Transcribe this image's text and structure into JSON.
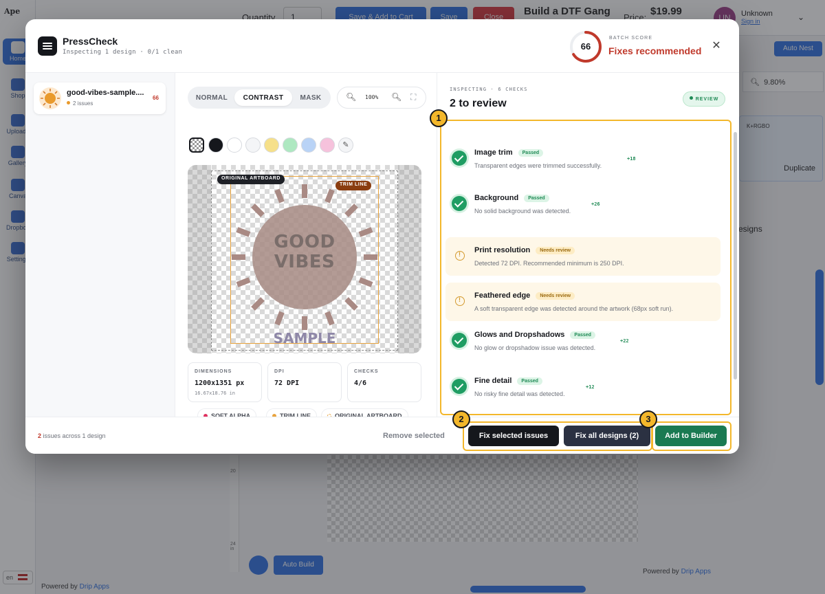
{
  "background_app": {
    "logo_text": "Ape",
    "nav": [
      {
        "label": "Home",
        "active": true
      },
      {
        "label": "Shop",
        "active": false
      },
      {
        "label": "Uploads",
        "active": false
      },
      {
        "label": "Gallery",
        "active": false
      },
      {
        "label": "Canva",
        "active": false
      },
      {
        "label": "Dropbox",
        "active": false
      },
      {
        "label": "Settings",
        "active": false
      }
    ],
    "quantity_label": "Quantity",
    "quantity_value": "1",
    "buttons": {
      "save_add_cart": "Save & Add to Cart",
      "save": "Save",
      "close": "Close"
    },
    "page_title": "Build a DTF Gang",
    "price_label": "Price:",
    "price": "$19.99",
    "user": {
      "initials": "UN",
      "name": "Unknown",
      "sign_in": "Sign in"
    },
    "auto_nest": "Auto Nest",
    "zoom": "9.80%",
    "card_meta": "K+RGBO",
    "duplicate": "Duplicate",
    "designs_text": "esigns",
    "auto_build": "Auto Build",
    "ruler_marks": [
      "20",
      "24 in"
    ],
    "powered_by_prefix": "Powered by",
    "powered_by_brand": "Drip Apps",
    "lang": "en"
  },
  "modal": {
    "app_name": "PressCheck",
    "subtitle": "Inspecting 1 design · 0/1 clean",
    "batch_score_label": "BATCH SCORE",
    "batch_score": 66,
    "batch_status": "Fixes recommended",
    "close_glyph": "✕"
  },
  "designs": [
    {
      "name": "good-vibes-sample....",
      "issues": "2 issues",
      "score": "66"
    }
  ],
  "preview": {
    "modes": [
      "NORMAL",
      "CONTRAST",
      "MASK"
    ],
    "active_mode": "CONTRAST",
    "zoom": "100%",
    "swatches": [
      "checker",
      "#15171c",
      "#ffffff",
      "#f4f5f7",
      "#f6e08a",
      "#aee8c1",
      "#b9d3f6",
      "#f6c2dc",
      "picker"
    ],
    "tags": {
      "original_artboard": "ORIGINAL ARTBOARD",
      "trim_line": "TRIM LINE"
    },
    "art_lines": [
      "GOOD",
      "VIBES"
    ],
    "art_sample": "SAMPLE",
    "stats": [
      {
        "label": "DIMENSIONS",
        "value": "1200x1351 px",
        "sub": "16.67x18.76 in"
      },
      {
        "label": "DPI",
        "value": "72 DPI",
        "sub": ""
      },
      {
        "label": "CHECKS",
        "value": "4/6",
        "sub": ""
      }
    ],
    "legend": [
      {
        "label": "SOFT ALPHA",
        "color": "#e0315f"
      },
      {
        "label": "TRIM LINE",
        "color": "#e8a33d"
      },
      {
        "label": "ORIGINAL ARTBOARD",
        "color": "#e8a33d"
      }
    ]
  },
  "checks_panel": {
    "label": "INSPECTING · 6 CHECKS",
    "title": "2 to review",
    "pill": "REVIEW",
    "items": [
      {
        "title": "Image trim",
        "status": "Passed",
        "kind": "ok",
        "desc": "Transparent edges were trimmed successfully.",
        "delta": "+18"
      },
      {
        "title": "Background",
        "status": "Passed",
        "kind": "ok",
        "desc": "No solid background was detected.",
        "delta": "+26"
      },
      {
        "title": "Print resolution",
        "status": "Needs review",
        "kind": "rv",
        "desc": "Detected 72 DPI. Recommended minimum is 250 DPI.",
        "delta": ""
      },
      {
        "title": "Feathered edge",
        "status": "Needs review",
        "kind": "rv",
        "desc": "A soft transparent edge was detected around the artwork (68px soft run).",
        "delta": ""
      },
      {
        "title": "Glows and Dropshadows",
        "status": "Passed",
        "kind": "ok",
        "desc": "No glow or dropshadow issue was detected.",
        "delta": "+22"
      },
      {
        "title": "Fine detail",
        "status": "Passed",
        "kind": "ok",
        "desc": "No risky fine detail was detected.",
        "delta": "+12"
      }
    ]
  },
  "footer": {
    "issue_count": "2",
    "issue_text": " issues across 1 design",
    "remove_selected": "Remove selected",
    "fix_selected": "Fix selected issues",
    "fix_all": "Fix all designs (2)",
    "add_to_builder": "Add to Builder"
  },
  "annotations": [
    "1",
    "2",
    "3"
  ],
  "colors": {
    "accent_green": "#1f9d63",
    "warning": "#d49a2e",
    "danger": "#c0392b",
    "highlight": "#f3b72b",
    "dark": "#16181d"
  }
}
